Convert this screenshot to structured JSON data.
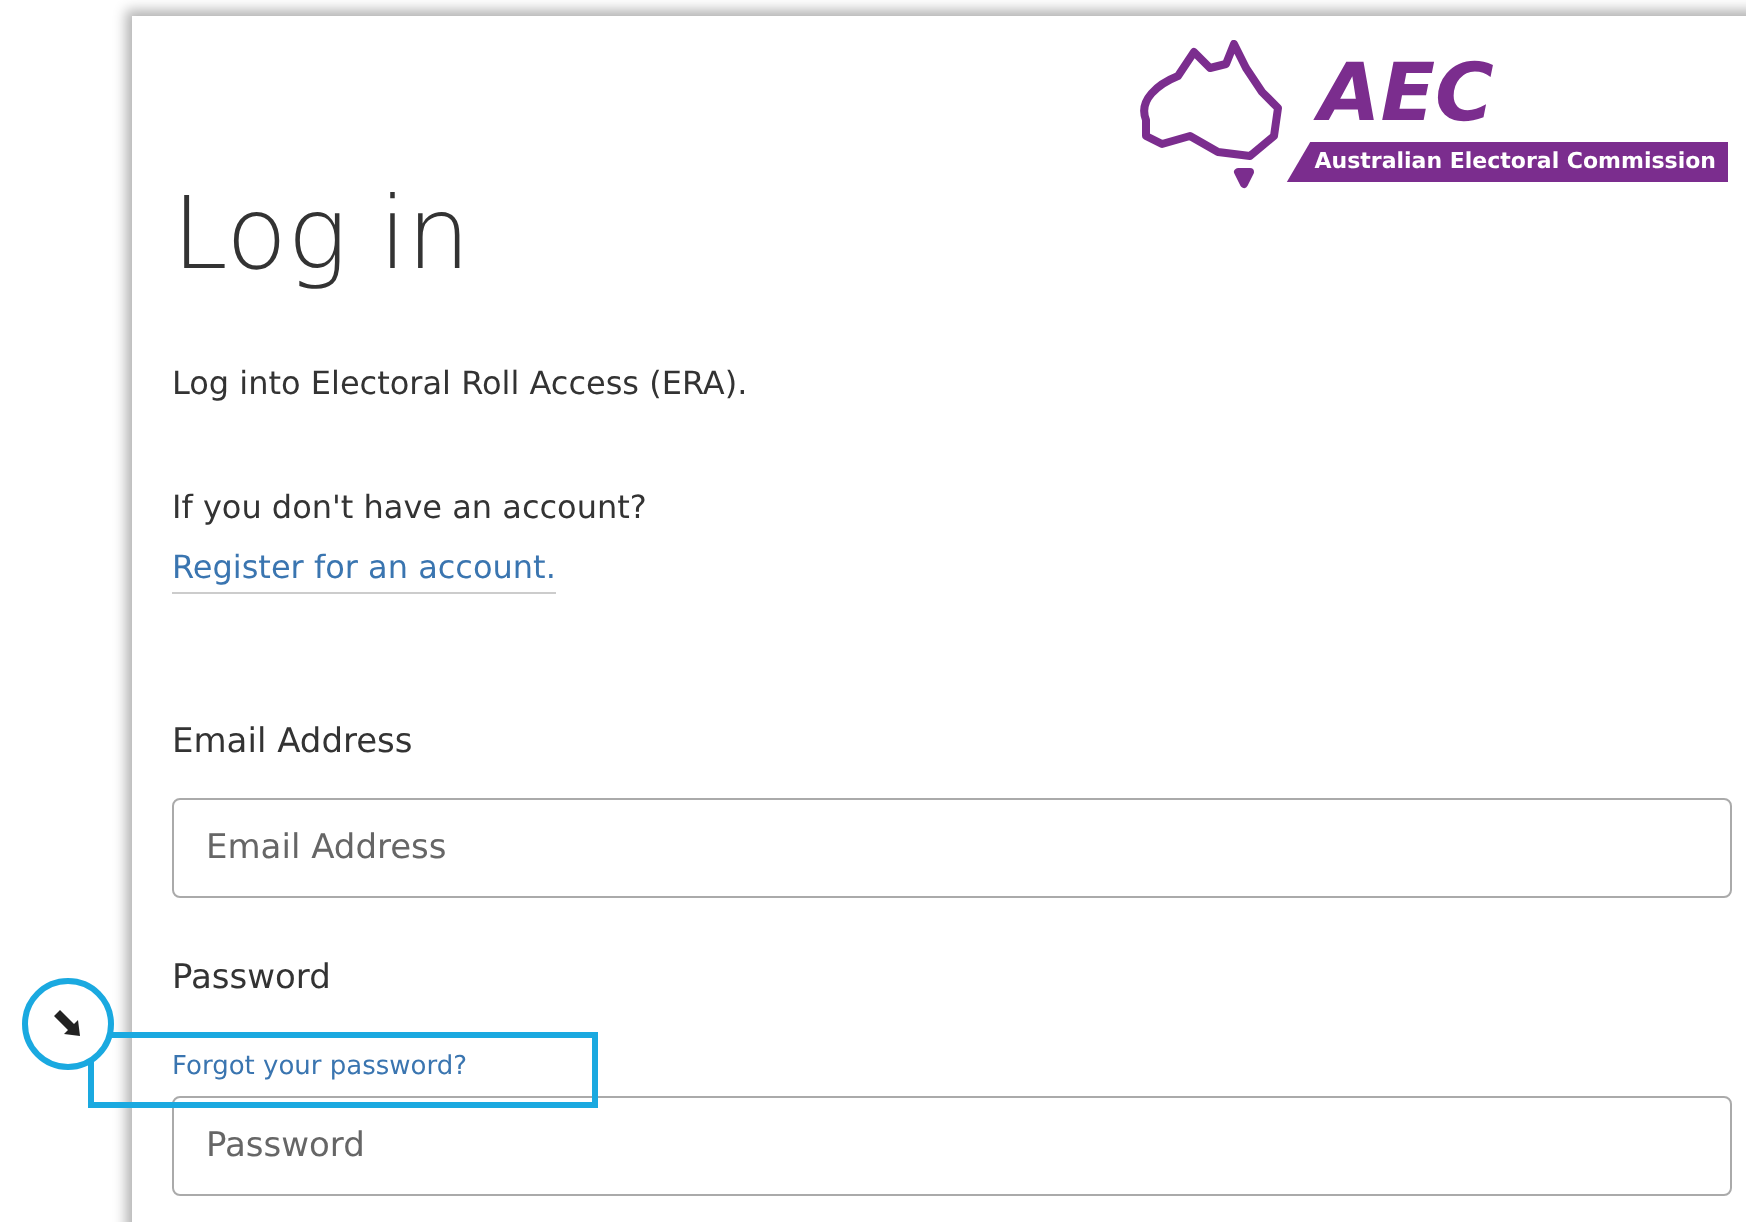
{
  "logo": {
    "acronym": "AEC",
    "name": "Australian Electoral Commission"
  },
  "heading": "Log in",
  "intro": "Log into Electoral Roll Access (ERA).",
  "account_prompt": "If you don't have an account?",
  "register_link": "Register for an account.",
  "fields": [
    {
      "label": "Email Address",
      "placeholder": "Email Address"
    },
    {
      "label": "Password",
      "placeholder": "Password",
      "link": "Forgot your password?"
    }
  ]
}
